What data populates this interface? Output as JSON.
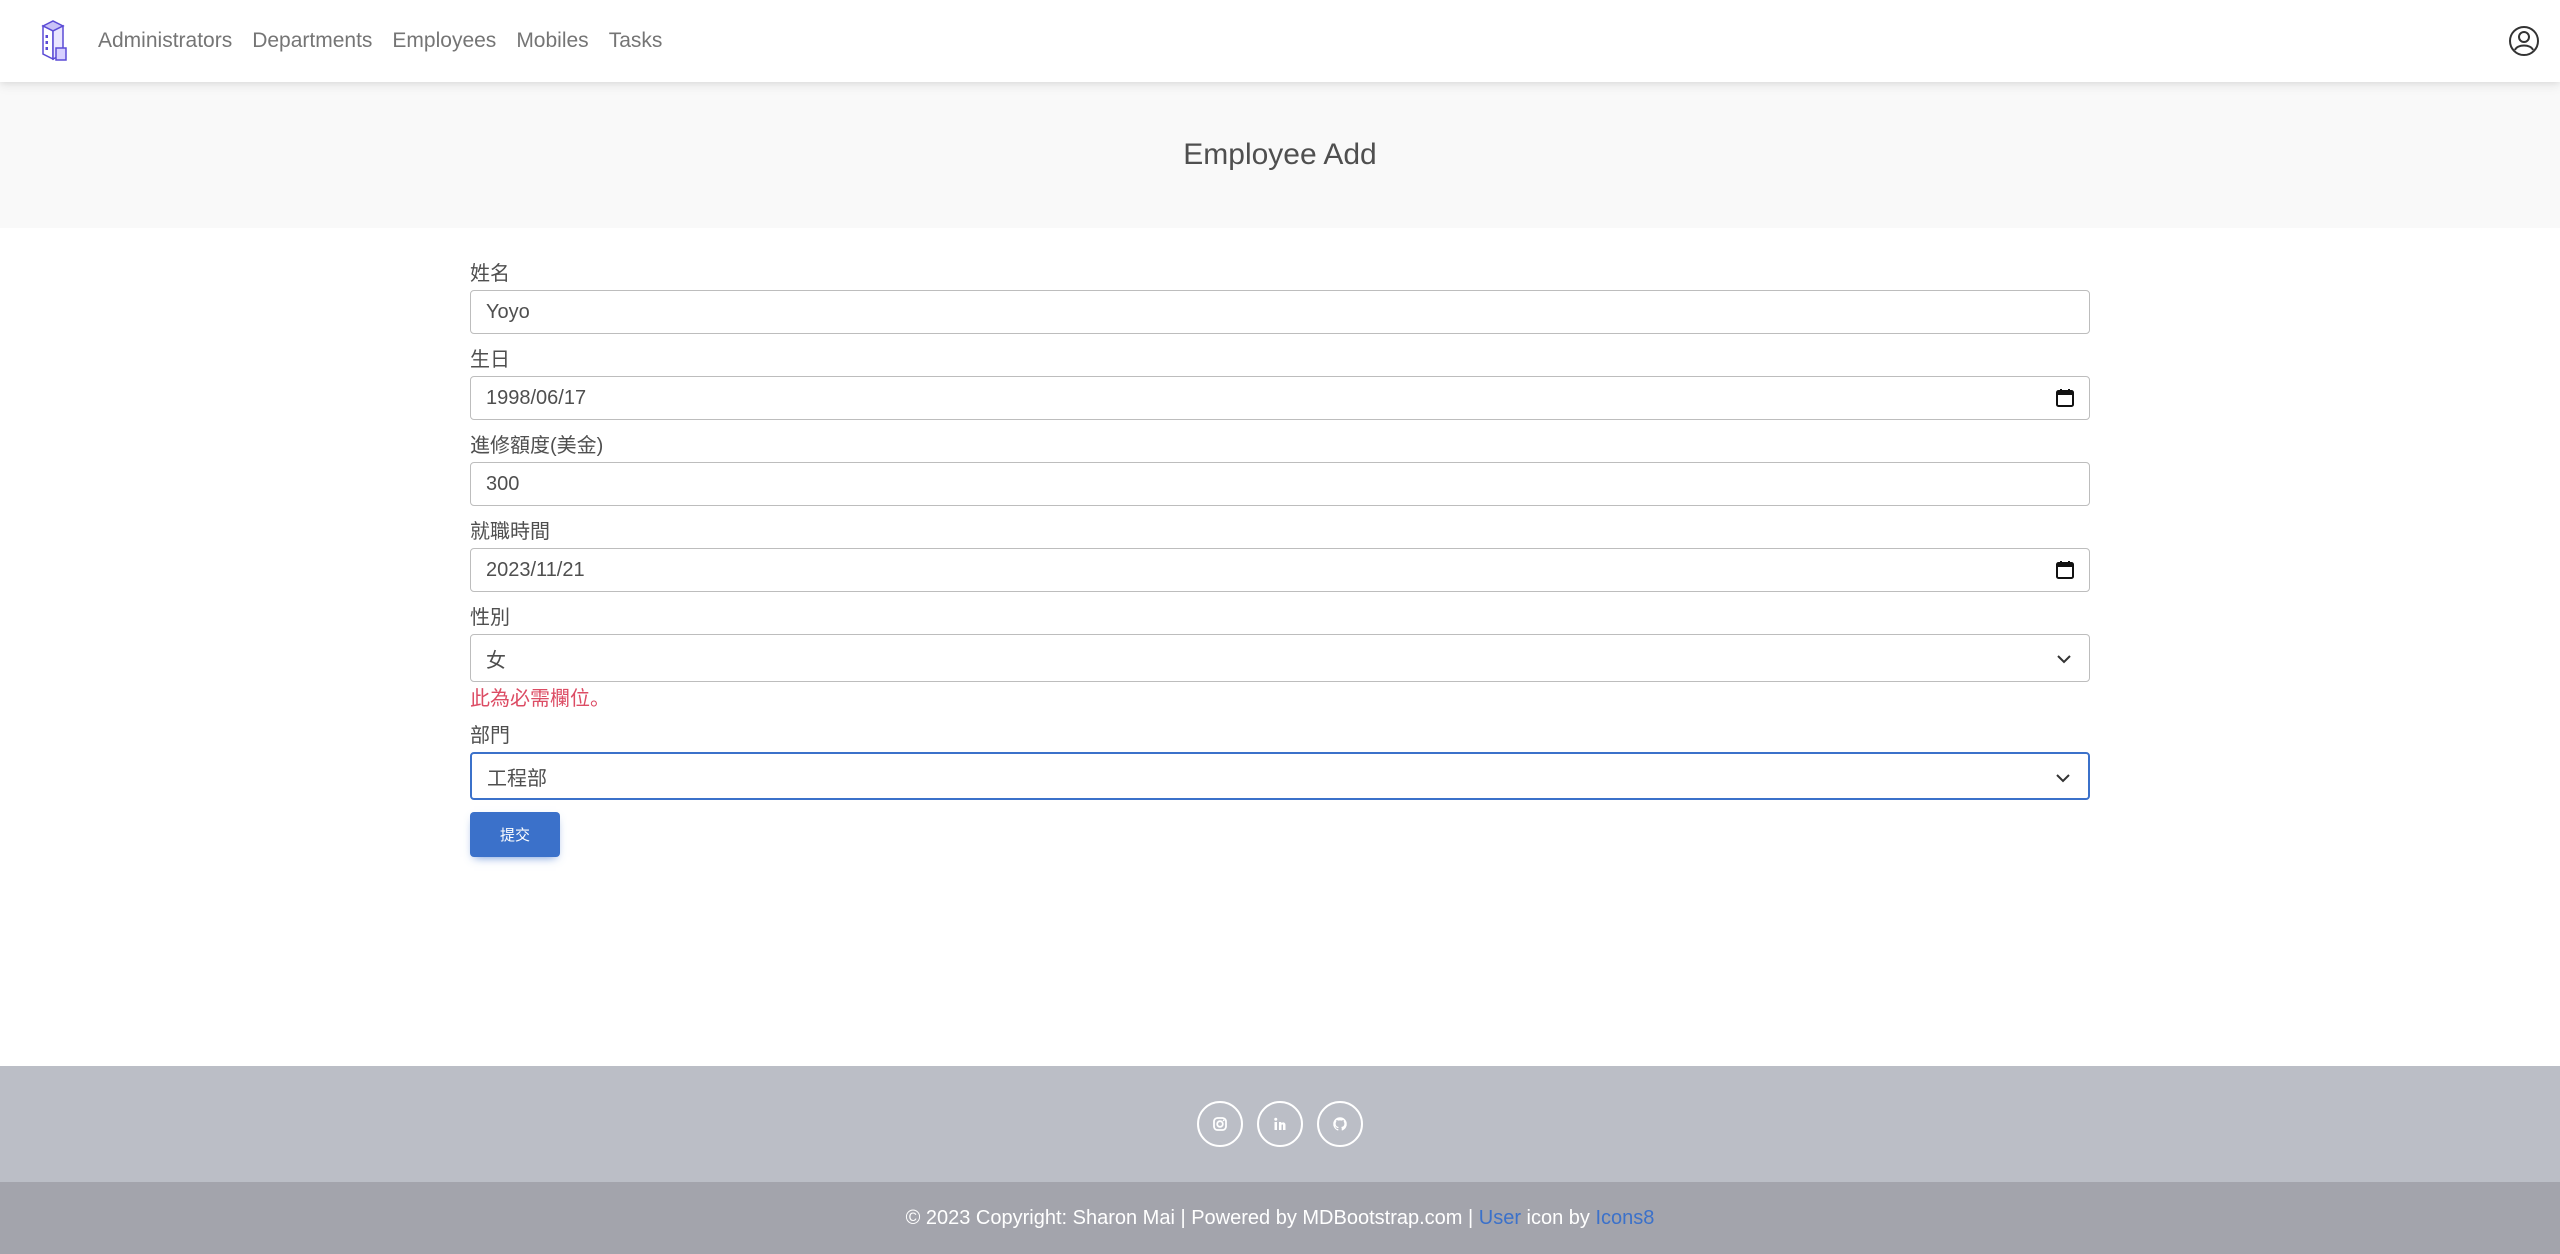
{
  "nav": {
    "items": [
      {
        "label": "Administrators"
      },
      {
        "label": "Departments"
      },
      {
        "label": "Employees"
      },
      {
        "label": "Mobiles"
      },
      {
        "label": "Tasks"
      }
    ]
  },
  "header": {
    "title": "Employee Add"
  },
  "form": {
    "name": {
      "label": "姓名",
      "value": "Yoyo"
    },
    "birthday": {
      "label": "生日",
      "value": "1998/06/17"
    },
    "budget": {
      "label": "進修額度(美金)",
      "value": "300"
    },
    "hire_date": {
      "label": "就職時間",
      "value": "2023/11/21"
    },
    "gender": {
      "label": "性別",
      "value": "女",
      "error": "此為必需欄位。"
    },
    "department": {
      "label": "部門",
      "value": "工程部"
    },
    "submit_label": "提交"
  },
  "footer": {
    "copyright": "© 2023 Copyright: Sharon Mai | Powered by MDBootstrap.com | ",
    "user_link": "User",
    "icon_by": " icon by ",
    "icons8_link": "Icons8",
    "social": [
      "instagram-icon",
      "linkedin-icon",
      "github-icon"
    ]
  },
  "colors": {
    "primary": "#3b71ca",
    "error": "#dc4c64",
    "footer_top": "#bbbec6",
    "footer_bottom": "#a3a4ac"
  }
}
